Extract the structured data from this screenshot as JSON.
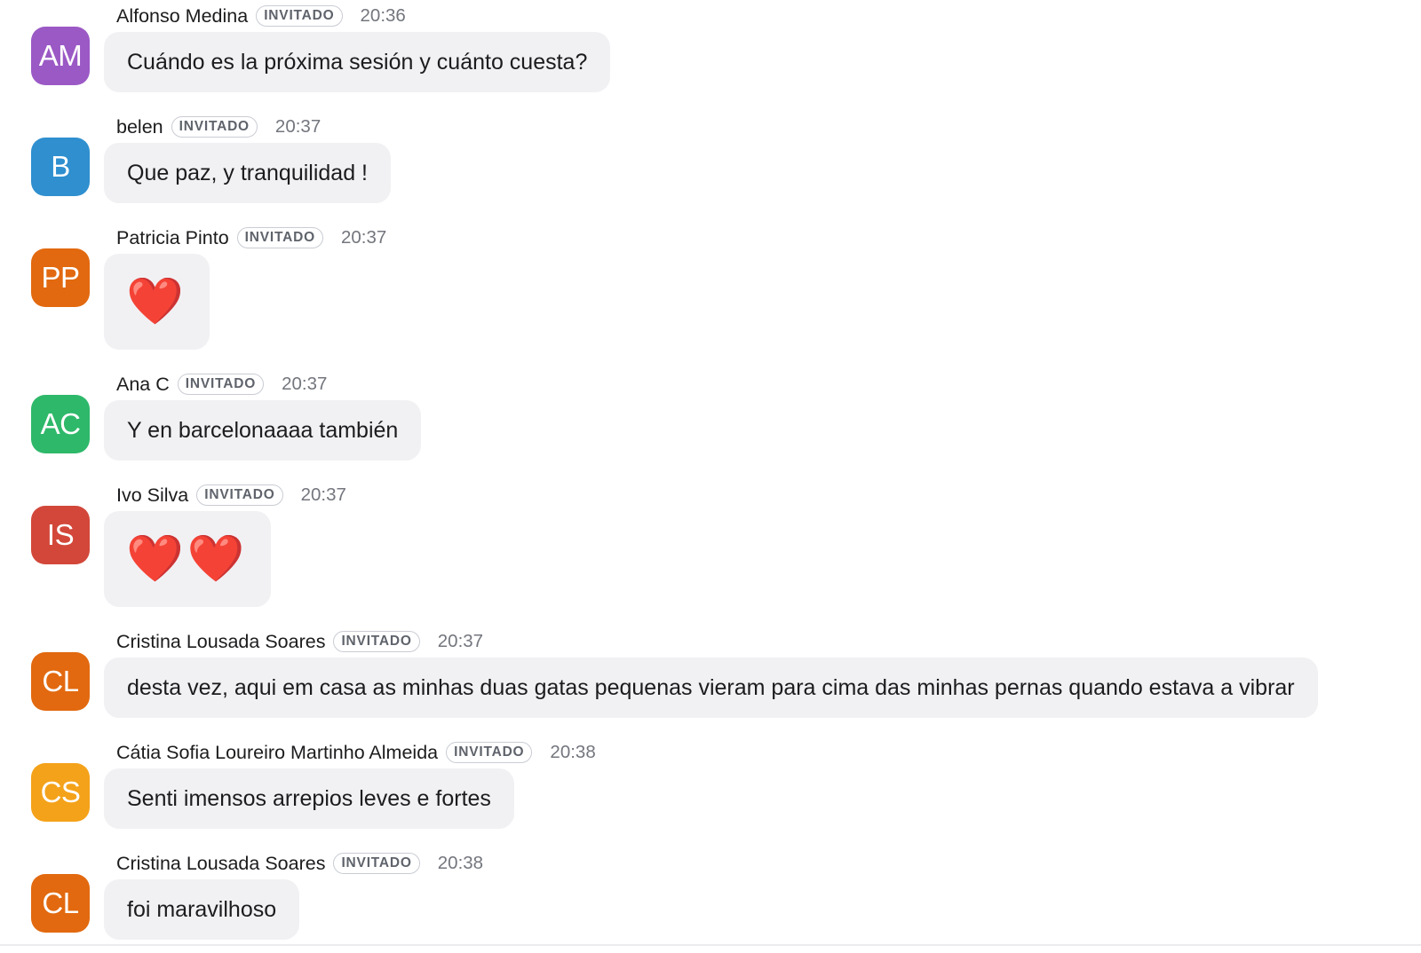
{
  "messages": [
    {
      "initials": "AM",
      "avatar_color": "#9b59c5",
      "sender": "Alfonso Medina",
      "badge": "INVITADO",
      "time": "20:36",
      "text": "Cuándo es la próxima sesión y cuánto cuesta?"
    },
    {
      "initials": "B",
      "avatar_color": "#2f8fcf",
      "sender": "belen",
      "badge": "INVITADO",
      "time": "20:37",
      "text": "Que paz, y tranquilidad !"
    },
    {
      "initials": "PP",
      "avatar_color": "#e2690f",
      "sender": "Patricia Pinto",
      "badge": "INVITADO",
      "time": "20:37",
      "text": "❤️"
    },
    {
      "initials": "AC",
      "avatar_color": "#2eb86a",
      "sender": "Ana C",
      "badge": "INVITADO",
      "time": "20:37",
      "text": "Y en barcelonaaaa también"
    },
    {
      "initials": "IS",
      "avatar_color": "#d2473a",
      "sender": "Ivo Silva",
      "badge": "INVITADO",
      "time": "20:37",
      "text": "❤️❤️"
    },
    {
      "initials": "CL",
      "avatar_color": "#e2690f",
      "sender": "Cristina Lousada Soares",
      "badge": "INVITADO",
      "time": "20:37",
      "text": "desta vez, aqui em casa as minhas duas gatas pequenas vieram para cima das minhas pernas quando estava a vibrar"
    },
    {
      "initials": "CS",
      "avatar_color": "#f4a21a",
      "sender": "Cátia Sofia Loureiro Martinho Almeida",
      "badge": "INVITADO",
      "time": "20:38",
      "text": "Senti imensos arrepios leves e fortes"
    },
    {
      "initials": "CL",
      "avatar_color": "#e2690f",
      "sender": "Cristina Lousada Soares",
      "badge": "INVITADO",
      "time": "20:38",
      "text": "foi maravilhoso"
    }
  ]
}
